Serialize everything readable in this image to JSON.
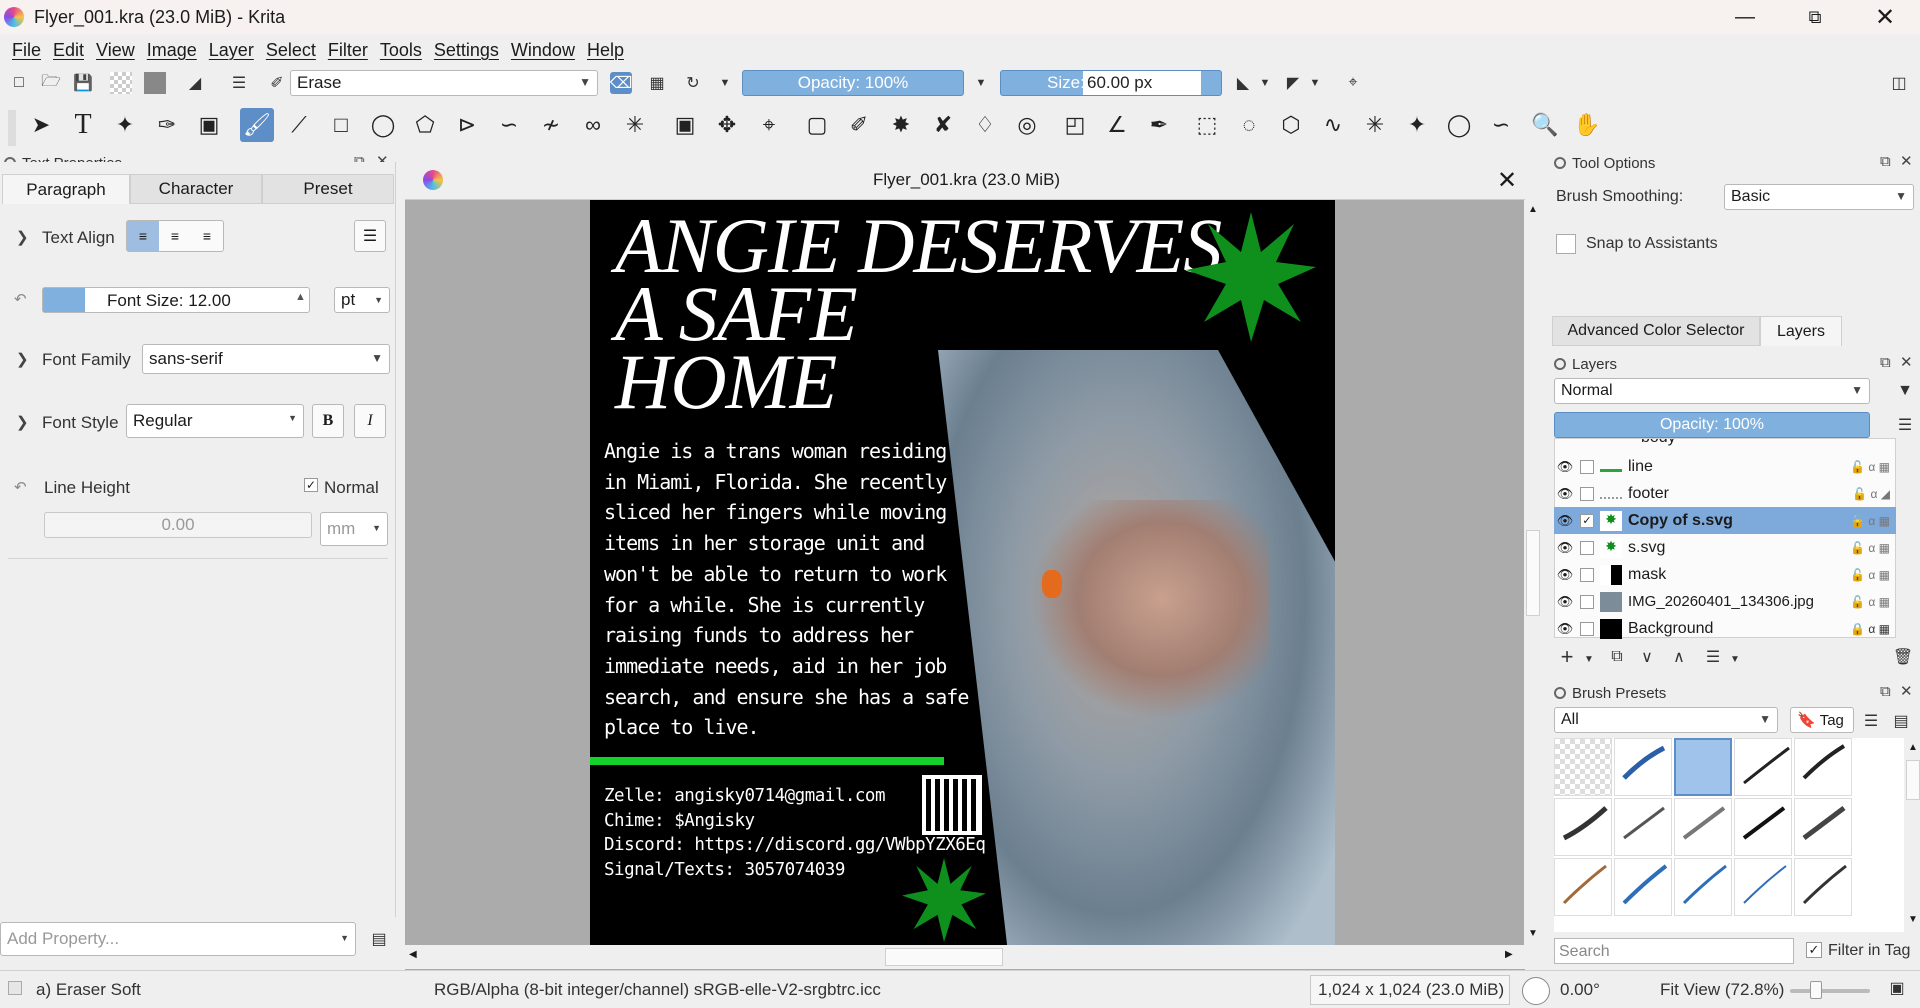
{
  "window": {
    "title": "Flyer_001.kra (23.0 MiB)  - Krita"
  },
  "menu": [
    "File",
    "Edit",
    "View",
    "Image",
    "Layer",
    "Select",
    "Filter",
    "Tools",
    "Settings",
    "Window",
    "Help"
  ],
  "toolbar": {
    "preset": "Erase",
    "opacity": "Opacity: 100%",
    "size_label": "Size:",
    "size_value": "60.00 px"
  },
  "text_properties": {
    "title": "Text Properties",
    "tabs": [
      "Paragraph",
      "Character",
      "Preset"
    ],
    "text_align": "Text Align",
    "font_size": "Font Size: 12.00",
    "font_unit": "pt",
    "font_family_label": "Font Family",
    "font_family": "sans-serif",
    "font_style_label": "Font Style",
    "font_style": "Regular",
    "bold": "B",
    "italic": "I",
    "line_height": "Line Height",
    "normal": "Normal",
    "line_value": "0.00",
    "line_unit": "mm",
    "add_property": "Add Property..."
  },
  "document": {
    "tab_title": "Flyer_001.kra (23.0 MiB)",
    "headline": [
      "ANGIE DESERVES",
      "A SAFE",
      "HOME"
    ],
    "body": [
      "Angie is a trans woman residing",
      "in Miami, Florida. She recently",
      "sliced her fingers while moving",
      "items in her storage unit and",
      "won't be able to return to work",
      "for a while. She is currently",
      "raising funds to address her",
      "immediate needs, aid in her job",
      "search, and ensure she has a safe",
      "place to live."
    ],
    "contact": [
      "Zelle: angisky0714@gmail.com",
      "Chime: $Angisky",
      "Discord: https://discord.gg/VWbpYZX6Eq",
      "Signal/Texts: 3057074039"
    ]
  },
  "tool_options": {
    "title": "Tool Options",
    "smoothing_label": "Brush Smoothing:",
    "smoothing": "Basic",
    "snap": "Snap to Assistants"
  },
  "right_tabs": [
    "Advanced Color Selector",
    "Layers"
  ],
  "layers": {
    "title": "Layers",
    "blend": "Normal",
    "opacity": "Opacity: 100%",
    "partial": "body",
    "items": [
      {
        "name": "line"
      },
      {
        "name": "footer"
      },
      {
        "name": "Copy of s.svg"
      },
      {
        "name": "s.svg"
      },
      {
        "name": "mask"
      },
      {
        "name": "IMG_20260401_134306.jpg"
      },
      {
        "name": "Background"
      }
    ]
  },
  "brush_presets": {
    "title": "Brush Presets",
    "filter": "All",
    "tag": "Tag",
    "search": "Search",
    "filter_in_tag": "Filter in Tag"
  },
  "status": {
    "brush": "a) Eraser Soft",
    "color": "RGB/Alpha (8-bit integer/channel)  sRGB-elle-V2-srgbtrc.icc",
    "dims": "1,024 x 1,024 (23.0 MiB)",
    "rotation": "0.00°",
    "zoom": "Fit View (72.8%)"
  }
}
